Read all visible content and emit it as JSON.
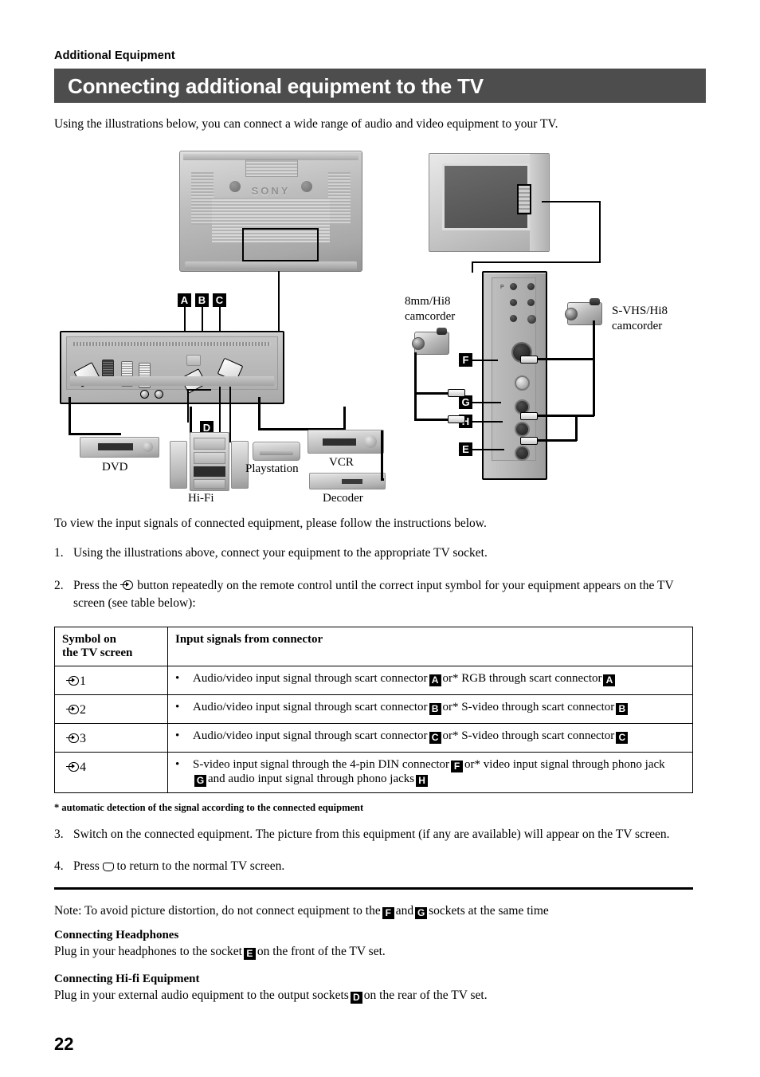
{
  "header": {
    "kicker": "Additional Equipment",
    "title": "Connecting additional equipment to the TV"
  },
  "intro": "Using the illustrations below, you can connect a wide range of audio and video equipment to your TV.",
  "diagram": {
    "rear_tv_brand": "SONY",
    "tags": {
      "a": "A",
      "b": "B",
      "c": "C",
      "d": "D",
      "e": "E",
      "f": "F",
      "g": "G",
      "h": "H"
    },
    "labels": {
      "dvd": "DVD",
      "hifi": "Hi-Fi",
      "playstation": "Playstation",
      "vcr": "VCR",
      "decoder": "Decoder",
      "camcorder_8mm": "8mm/Hi8\ncamcorder",
      "camcorder_8mm_line1": "8mm/Hi8",
      "camcorder_8mm_line2": "camcorder",
      "camcorder_svhs_line1": "S-VHS/Hi8",
      "camcorder_svhs_line2": "camcorder"
    },
    "side_panel_buttons": [
      "P",
      "-",
      "+"
    ]
  },
  "body": {
    "lead": "To view the input signals of connected equipment, please follow the instructions below.",
    "step1_num": "1.",
    "step1": "Using the illustrations above, connect your equipment to the appropriate TV socket.",
    "step2_num": "2.",
    "step2_a": "Press the",
    "step2_b": "button repeatedly on the remote control until the correct input symbol for your equipment appears on the TV",
    "step2_c": "screen (see table below):",
    "step3_num": "3.",
    "step3": "Switch on the connected equipment. The picture from this equipment (if any are available) will appear on the TV screen.",
    "step4_num": "4.",
    "step4_a": "Press",
    "step4_b": "to return to the normal TV screen."
  },
  "table": {
    "head_col1_line1": "Symbol on",
    "head_col1_line2": "the TV screen",
    "head_col2": "Input signals from connector",
    "rows": [
      {
        "symbol_num": "1",
        "text_a": "Audio/video input signal through scart connector",
        "tag1": "A",
        "text_b": "or* RGB through scart connector",
        "tag2": "A",
        "text_c": "",
        "tag3": ""
      },
      {
        "symbol_num": "2",
        "text_a": "Audio/video input signal through scart connector",
        "tag1": "B",
        "text_b": "or* S-video through scart connector",
        "tag2": "B",
        "text_c": "",
        "tag3": ""
      },
      {
        "symbol_num": "3",
        "text_a": "Audio/video input signal through scart connector",
        "tag1": "C",
        "text_b": "or* S-video through scart connector",
        "tag2": "C",
        "text_c": "",
        "tag3": ""
      },
      {
        "symbol_num": "4",
        "text_a": "S-video input signal through the 4-pin DIN connector",
        "tag1": "F",
        "text_b": "or* video input signal through phono jack",
        "tag2": "G",
        "text_c": "and audio input signal through phono jacks",
        "tag3": "H"
      }
    ]
  },
  "footnote": "* automatic detection of the signal according to the connected equipment",
  "notes": {
    "note_a": "Note: To avoid picture distortion, do not connect equipment to the",
    "note_tag1": "F",
    "note_b": "and",
    "note_tag2": "G",
    "note_c": "sockets at the same time",
    "headphones_title": "Connecting Headphones",
    "headphones_a": "Plug in your headphones to the socket",
    "headphones_tag": "E",
    "headphones_b": "on the front of the TV set.",
    "hifi_title": "Connecting Hi-fi Equipment",
    "hifi_a": "Plug in your external audio equipment to the output sockets",
    "hifi_tag": "D",
    "hifi_b": "on the rear of the TV set."
  },
  "page_number": "22",
  "colors": {
    "title_bar_bg": "#4d4d4d",
    "title_text": "#ffffff",
    "tag_bg": "#000000",
    "page_bg": "#ffffff"
  }
}
